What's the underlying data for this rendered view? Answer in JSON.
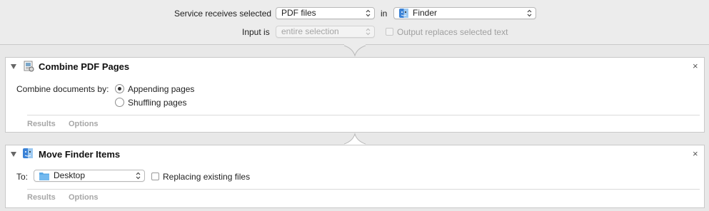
{
  "header": {
    "service_label": "Service receives selected",
    "service_value": "PDF files",
    "in_label": "in",
    "app_value": "Finder",
    "input_label": "Input is",
    "input_value": "entire selection",
    "output_checkbox_label": "Output replaces selected text"
  },
  "actions": [
    {
      "title": "Combine PDF Pages",
      "option_label": "Combine documents by:",
      "radio_options": [
        "Appending pages",
        "Shuffling pages"
      ],
      "selected_option": "Appending pages",
      "footer": [
        "Results",
        "Options"
      ]
    },
    {
      "title": "Move Finder Items",
      "to_label": "To:",
      "to_value": "Desktop",
      "replace_label": "Replacing existing files",
      "footer": [
        "Results",
        "Options"
      ]
    }
  ],
  "close_glyph": "×",
  "colors": {
    "folder": "#5aa9e6",
    "finder_blue": "#3b82d6"
  }
}
